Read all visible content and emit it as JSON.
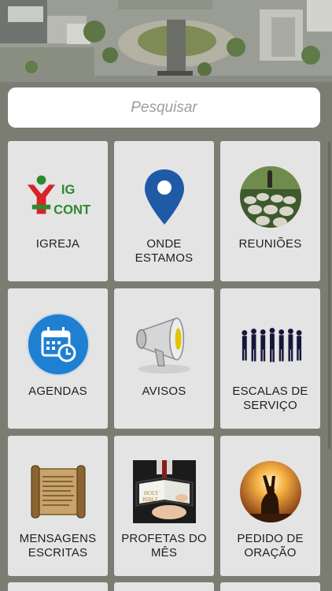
{
  "search": {
    "placeholder": "Pesquisar"
  },
  "tiles": [
    {
      "label": "IGREJA",
      "icon": "church-logo-icon"
    },
    {
      "label": "ONDE ESTAMOS",
      "icon": "map-pin-icon"
    },
    {
      "label": "REUNIÕES",
      "icon": "flock-sheep-icon"
    },
    {
      "label": "AGENDAS",
      "icon": "calendar-clock-icon"
    },
    {
      "label": "AVISOS",
      "icon": "megaphone-icon"
    },
    {
      "label": "ESCALAS DE SERVIÇO",
      "icon": "people-silhouettes-icon"
    },
    {
      "label": "MENSAGENS ESCRITAS",
      "icon": "scroll-icon"
    },
    {
      "label": "PROFETAS DO MÊS",
      "icon": "bible-reading-icon"
    },
    {
      "label": "PEDIDO DE ORAÇÃO",
      "icon": "praying-person-icon"
    }
  ],
  "logo": {
    "line1": "IG",
    "line2": "CONT"
  },
  "colors": {
    "background": "#7b7c72",
    "tile": "#e4e4e4",
    "pin": "#1f5aa6",
    "calendar": "#1f7fd1",
    "logo_green": "#2c8a2c",
    "logo_red": "#d8232a"
  }
}
